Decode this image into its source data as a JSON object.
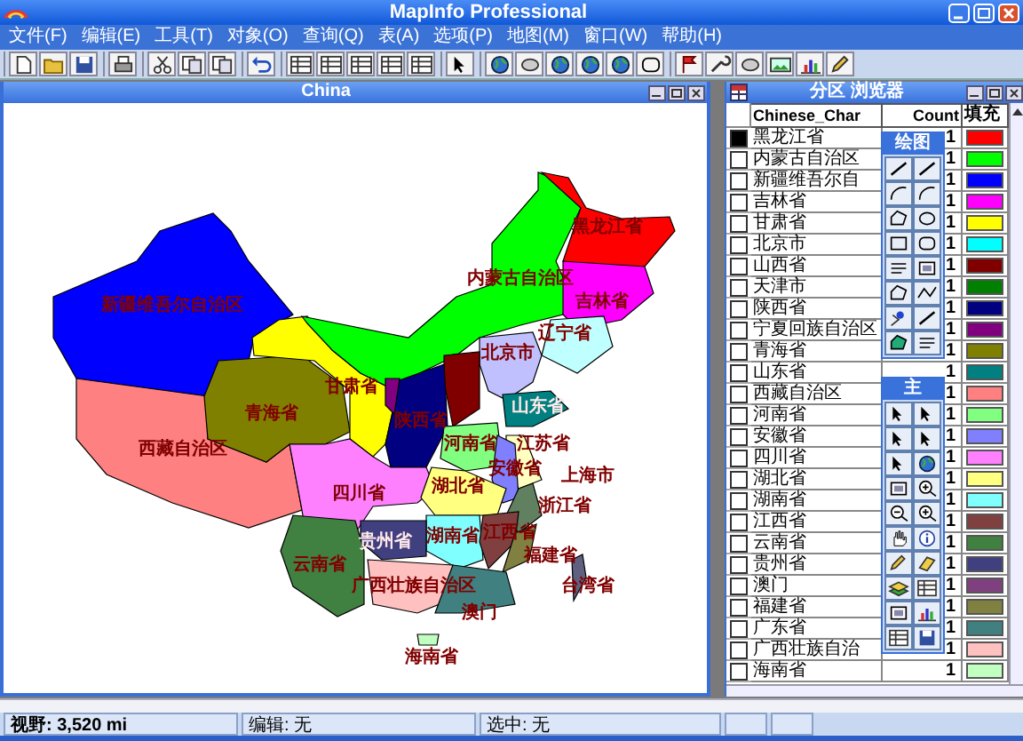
{
  "window": {
    "title": "MapInfo Professional"
  },
  "menu": [
    "文件(F)",
    "编辑(E)",
    "工具(T)",
    "对象(O)",
    "查询(Q)",
    "表(A)",
    "选项(P)",
    "地图(M)",
    "窗口(W)",
    "帮助(H)"
  ],
  "map_window": {
    "title": "China",
    "province_labels": [
      "黑龙江省",
      "内蒙古自治区",
      "新疆维吾尔自治区",
      "吉林省",
      "辽宁省",
      "北京市",
      "甘肃省",
      "青海省",
      "陕西省",
      "山东省",
      "西藏自治区",
      "河南省",
      "江苏省",
      "四川省",
      "湖北省",
      "安徽省",
      "上海市",
      "浙江省",
      "贵州省",
      "湖南省",
      "江西省",
      "云南省",
      "福建省",
      "广西壮族自治区",
      "台湾省",
      "澳门",
      "海南省"
    ]
  },
  "browser_window": {
    "title": "分区 浏览器",
    "columns": [
      "Chinese_Char",
      "Count",
      "填充"
    ],
    "rows": [
      {
        "name": "黑龙江省",
        "selected": true,
        "count": "1",
        "color": "#ff0000"
      },
      {
        "name": "内蒙古自治区",
        "selected": false,
        "count": "1",
        "color": "#00ff00"
      },
      {
        "name": "新疆维吾尔自",
        "selected": false,
        "count": "1",
        "color": "#0000ff"
      },
      {
        "name": "吉林省",
        "selected": false,
        "count": "1",
        "color": "#ff00ff"
      },
      {
        "name": "甘肃省",
        "selected": false,
        "count": "1",
        "color": "#ffff00"
      },
      {
        "name": "北京市",
        "selected": false,
        "count": "1",
        "color": "#00ffff"
      },
      {
        "name": "山西省",
        "selected": false,
        "count": "1",
        "color": "#800000"
      },
      {
        "name": "天津市",
        "selected": false,
        "count": "1",
        "color": "#008000"
      },
      {
        "name": "陕西省",
        "selected": false,
        "count": "1",
        "color": "#000080"
      },
      {
        "name": "宁夏回族自治区",
        "selected": false,
        "count": "1",
        "color": "#800080"
      },
      {
        "name": "青海省",
        "selected": false,
        "count": "1",
        "color": "#808000"
      },
      {
        "name": "山东省",
        "selected": false,
        "count": "1",
        "color": "#008080"
      },
      {
        "name": "西藏自治区",
        "selected": false,
        "count": "1",
        "color": "#ff8080"
      },
      {
        "name": "河南省",
        "selected": false,
        "count": "1",
        "color": "#80ff80"
      },
      {
        "name": "安徽省",
        "selected": false,
        "count": "1",
        "color": "#8080ff"
      },
      {
        "name": "四川省",
        "selected": false,
        "count": "1",
        "color": "#ff80ff"
      },
      {
        "name": "湖北省",
        "selected": false,
        "count": "1",
        "color": "#ffff80"
      },
      {
        "name": "湖南省",
        "selected": false,
        "count": "1",
        "color": "#80ffff"
      },
      {
        "name": "江西省",
        "selected": false,
        "count": "1",
        "color": "#804040"
      },
      {
        "name": "云南省",
        "selected": false,
        "count": "1",
        "color": "#408040"
      },
      {
        "name": "贵州省",
        "selected": false,
        "count": "1",
        "color": "#404080"
      },
      {
        "name": "澳门",
        "selected": false,
        "count": "1",
        "color": "#804080"
      },
      {
        "name": "福建省",
        "selected": false,
        "count": "1",
        "color": "#808040"
      },
      {
        "name": "广东省",
        "selected": false,
        "count": "1",
        "color": "#408080"
      },
      {
        "name": "广西壮族自治",
        "selected": false,
        "count": "1",
        "color": "#ffc0c0"
      },
      {
        "name": "海南省",
        "selected": false,
        "count": "1",
        "color": "#c0ffc0"
      }
    ]
  },
  "palettes": [
    {
      "title": "绘图"
    },
    {
      "title": "主"
    }
  ],
  "status_bar": [
    "视野: 3,520 mi",
    "编辑: 无",
    "选中: 无"
  ]
}
